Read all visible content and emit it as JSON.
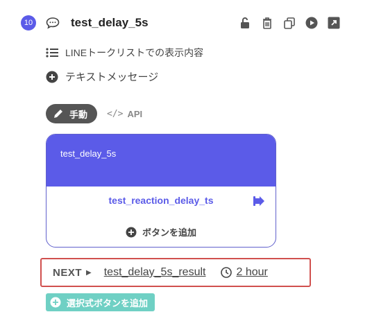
{
  "header": {
    "step_number": "10",
    "title": "test_delay_5s"
  },
  "rows": {
    "list_display": "LINEトークリストでの表示内容",
    "text_message": "テキストメッセージ"
  },
  "mode": {
    "manual_label": "手動",
    "api_label": "API",
    "api_code": "</>"
  },
  "card": {
    "title": "test_delay_5s",
    "button_label": "test_reaction_delay_ts",
    "add_button_label": "ボタンを追加"
  },
  "next": {
    "label": "NEXT",
    "target": "test_delay_5s_result",
    "delay": "2 hour"
  },
  "add_choice_label": "選択式ボタンを追加",
  "colors": {
    "accent": "#5b5be8",
    "teal": "#6fd0c4",
    "highlight": "#d0504e"
  }
}
